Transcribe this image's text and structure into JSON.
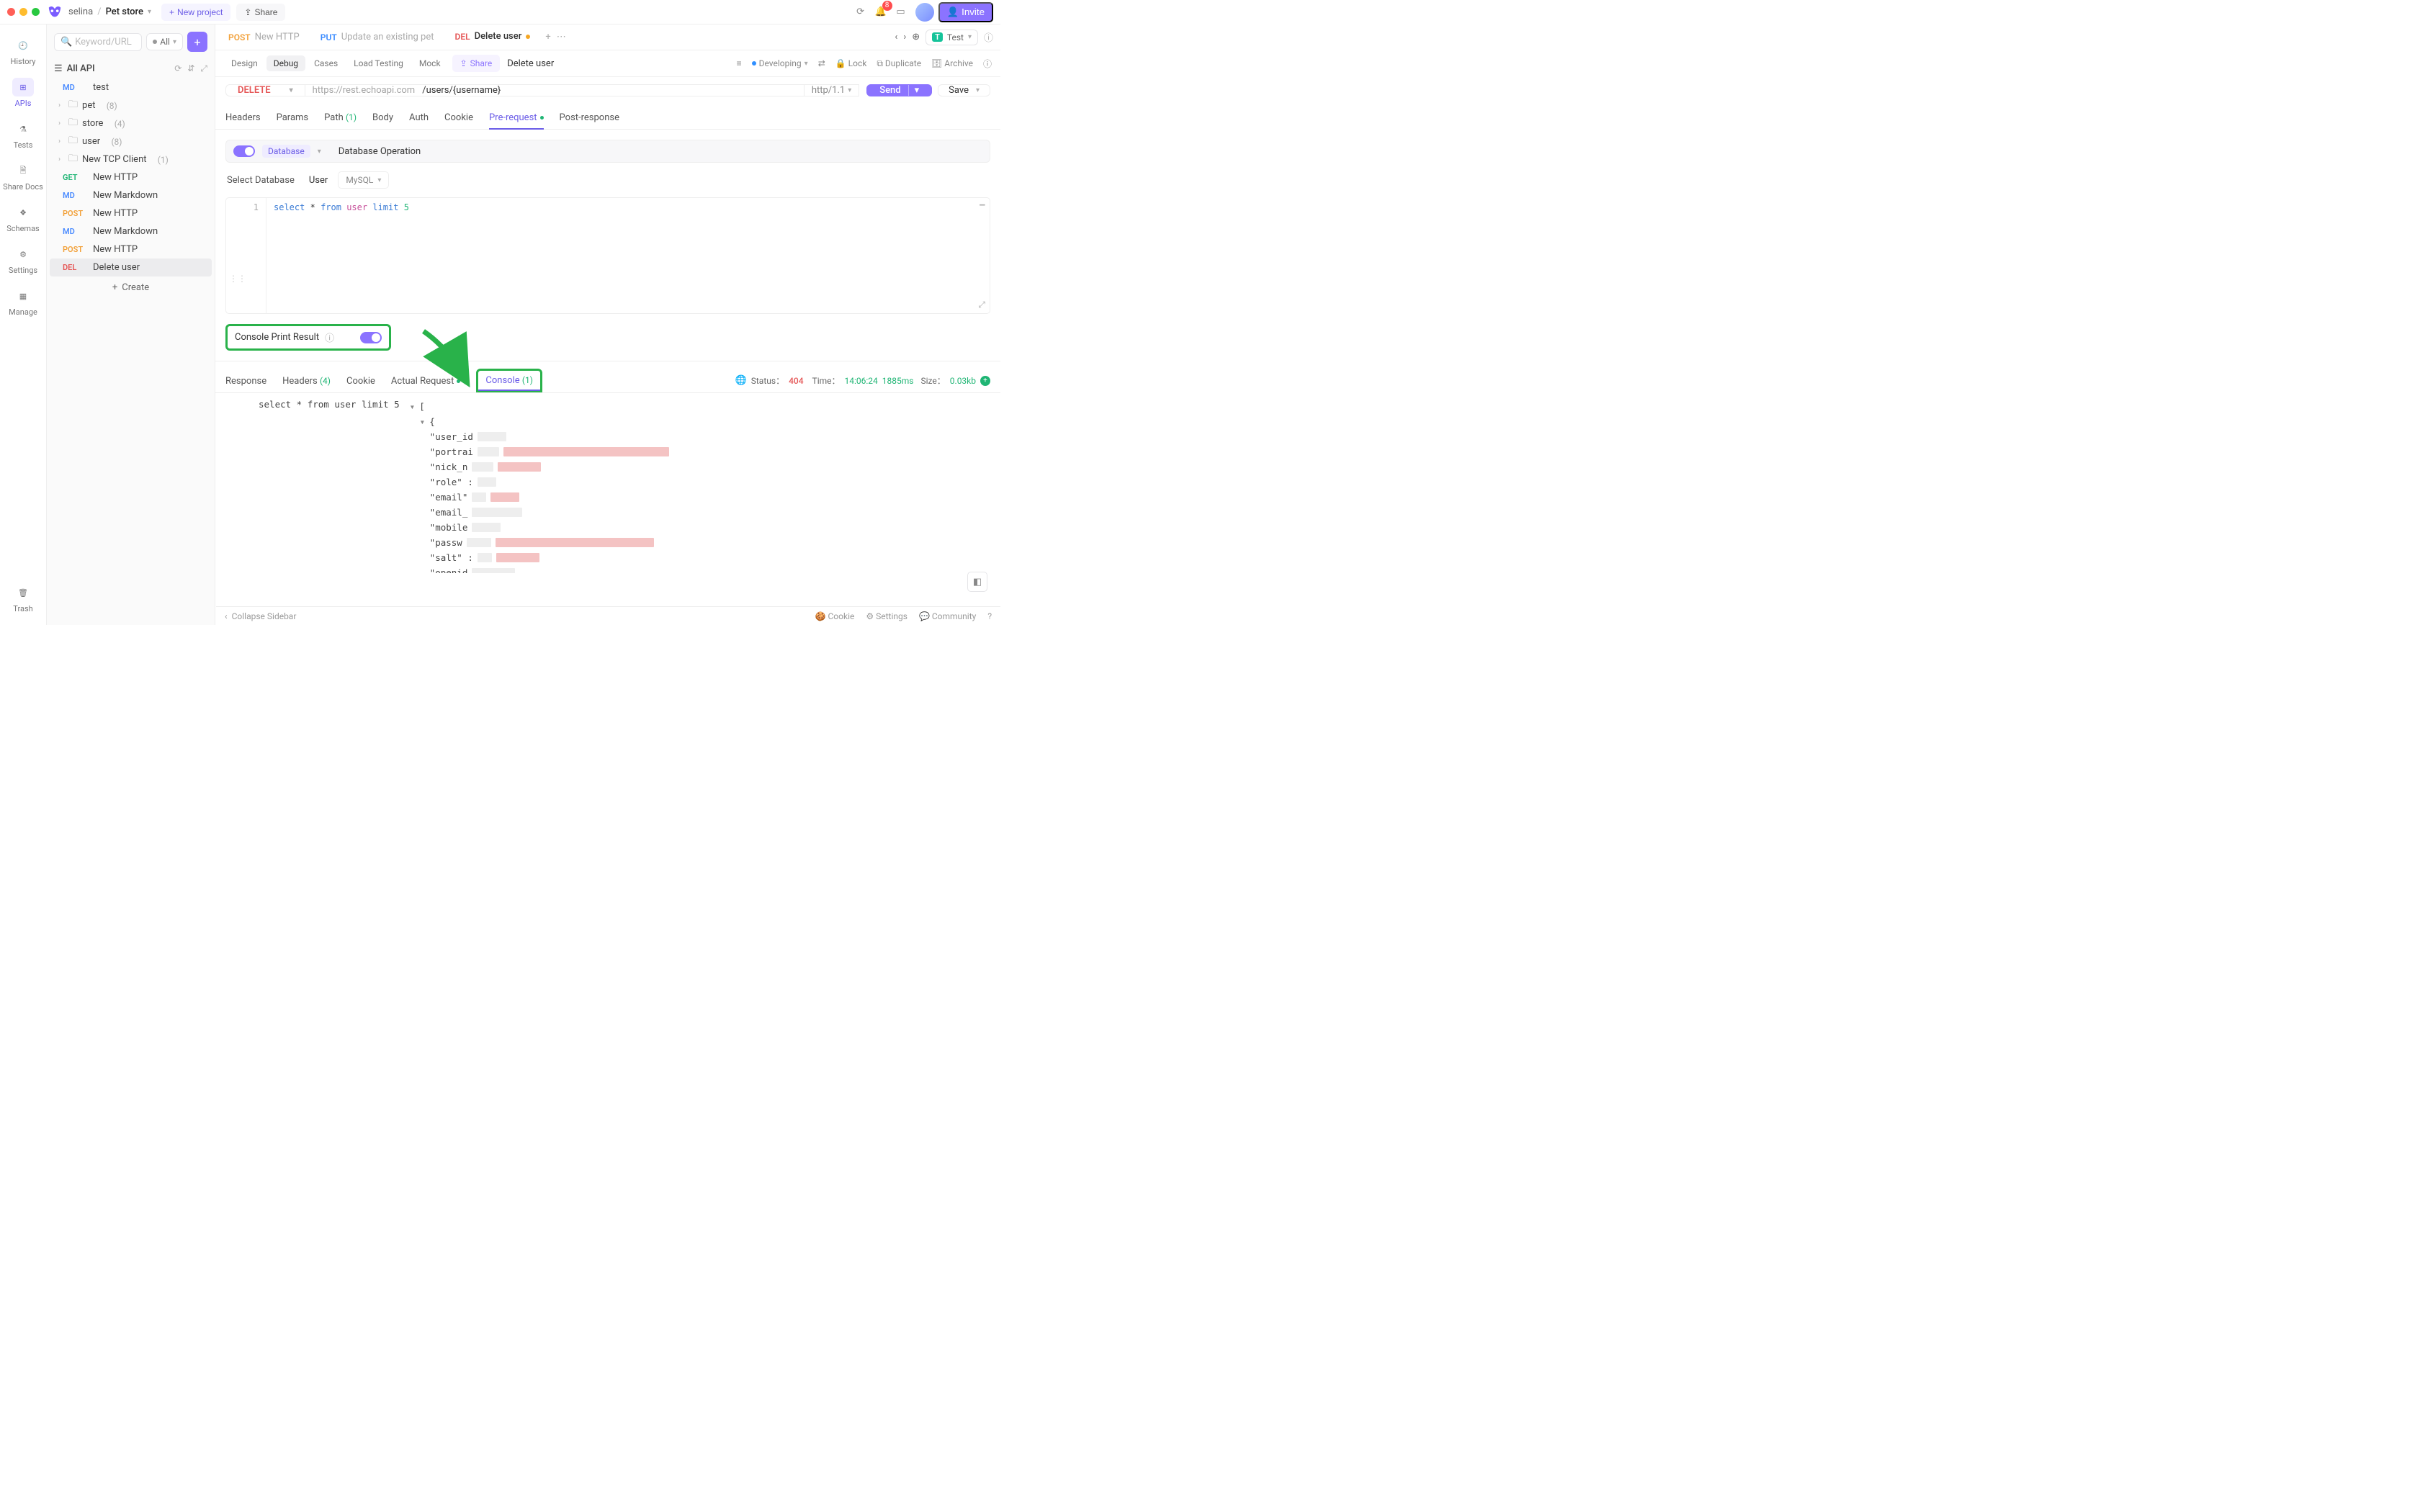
{
  "topbar": {
    "user": "selina",
    "project": "Pet store",
    "new_project": "New project",
    "share": "Share",
    "notif_badge": "8",
    "invite": "Invite"
  },
  "rail": {
    "items": [
      "History",
      "APIs",
      "Tests",
      "Share Docs",
      "Schemas",
      "Settings",
      "Manage"
    ],
    "trash": "Trash",
    "active": 1
  },
  "sidebar": {
    "search_placeholder": "Keyword/URL",
    "filter": "All",
    "header": "All API",
    "tree": [
      {
        "type": "item",
        "method": "MD",
        "name": "test",
        "indent": 1
      },
      {
        "type": "folder",
        "name": "pet",
        "count": "(8)",
        "indent": 0
      },
      {
        "type": "folder",
        "name": "store",
        "count": "(4)",
        "indent": 0
      },
      {
        "type": "folder",
        "name": "user",
        "count": "(8)",
        "indent": 0
      },
      {
        "type": "folder",
        "name": "New TCP Client",
        "count": "(1)",
        "indent": 0
      },
      {
        "type": "item",
        "method": "GET",
        "name": "New HTTP",
        "indent": 1
      },
      {
        "type": "item",
        "method": "MD",
        "name": "New Markdown",
        "indent": 1
      },
      {
        "type": "item",
        "method": "POST",
        "name": "New HTTP",
        "indent": 1
      },
      {
        "type": "item",
        "method": "MD",
        "name": "New Markdown",
        "indent": 1
      },
      {
        "type": "item",
        "method": "POST",
        "name": "New HTTP",
        "indent": 1
      },
      {
        "type": "item",
        "method": "DEL",
        "name": "Delete user",
        "indent": 1,
        "active": true
      }
    ],
    "create": "Create"
  },
  "tabs": {
    "items": [
      {
        "method": "POST",
        "mclass": "lbl-post",
        "title": "New HTTP"
      },
      {
        "method": "PUT",
        "mclass": "",
        "mcolor": "#3a8bff",
        "title": "Update an existing pet"
      },
      {
        "method": "DEL",
        "mclass": "lbl-del",
        "title": "Delete user",
        "active": true,
        "dirty": true
      }
    ],
    "nav_prev": "‹",
    "nav_next": "›",
    "env_label": "Test",
    "env_badge": "T"
  },
  "toolbar": {
    "segs": [
      "Design",
      "Debug",
      "Cases",
      "Load Testing",
      "Mock"
    ],
    "active_seg": 1,
    "share": "Share",
    "title": "Delete user",
    "status": "Developing",
    "ops": [
      "Lock",
      "Duplicate",
      "Archive"
    ]
  },
  "request": {
    "method": "DELETE",
    "host": "https://rest.echoapi.com",
    "path": "/users/{username}",
    "protocol": "http/1.1",
    "send": "Send",
    "save": "Save"
  },
  "subtabs": {
    "items": [
      {
        "label": "Headers"
      },
      {
        "label": "Params"
      },
      {
        "label": "Path",
        "suffix": "(1)",
        "sfx_green": true
      },
      {
        "label": "Body"
      },
      {
        "label": "Auth"
      },
      {
        "label": "Cookie"
      },
      {
        "label": "Pre-request",
        "active": true,
        "dot": true
      },
      {
        "label": "Post-response"
      }
    ]
  },
  "pre_request": {
    "type_chip": "Database",
    "op_label": "Database Operation",
    "select_db": "Select Database",
    "user_label": "User",
    "db_engine": "MySQL",
    "code_line_no": "1",
    "code_tokens": {
      "t1": "select",
      "t2": "*",
      "t3": "from",
      "t4": "user",
      "t5": "limit",
      "t6": "5"
    },
    "print_label": "Console Print Result"
  },
  "response": {
    "tabs": [
      {
        "label": "Response"
      },
      {
        "label": "Headers",
        "suffix": "(4)"
      },
      {
        "label": "Cookie"
      },
      {
        "label": "Actual Request",
        "dot": true
      },
      {
        "label": "Console",
        "suffix": "(1)",
        "active": true,
        "boxed": true
      }
    ],
    "meta": {
      "status_lbl": "Status：",
      "status_code": "404",
      "time_lbl": "Time：",
      "time_val": "14:06:24",
      "time_ms": "1885ms",
      "size_lbl": "Size：",
      "size_val": "0.03kb"
    },
    "console": {
      "left_text": "select * from user limit 5",
      "open_bracket": "[",
      "open_brace": "{",
      "keys": [
        "\"user_id",
        "\"portrai",
        "\"nick_n",
        "\"role\" :",
        "\"email\"",
        "\"email_",
        "\"mobile",
        "\"passw",
        "\"salt\" :",
        "\"openid"
      ]
    }
  },
  "footer": {
    "collapse": "Collapse Sidebar",
    "links": [
      "Cookie",
      "Settings",
      "Community"
    ]
  }
}
